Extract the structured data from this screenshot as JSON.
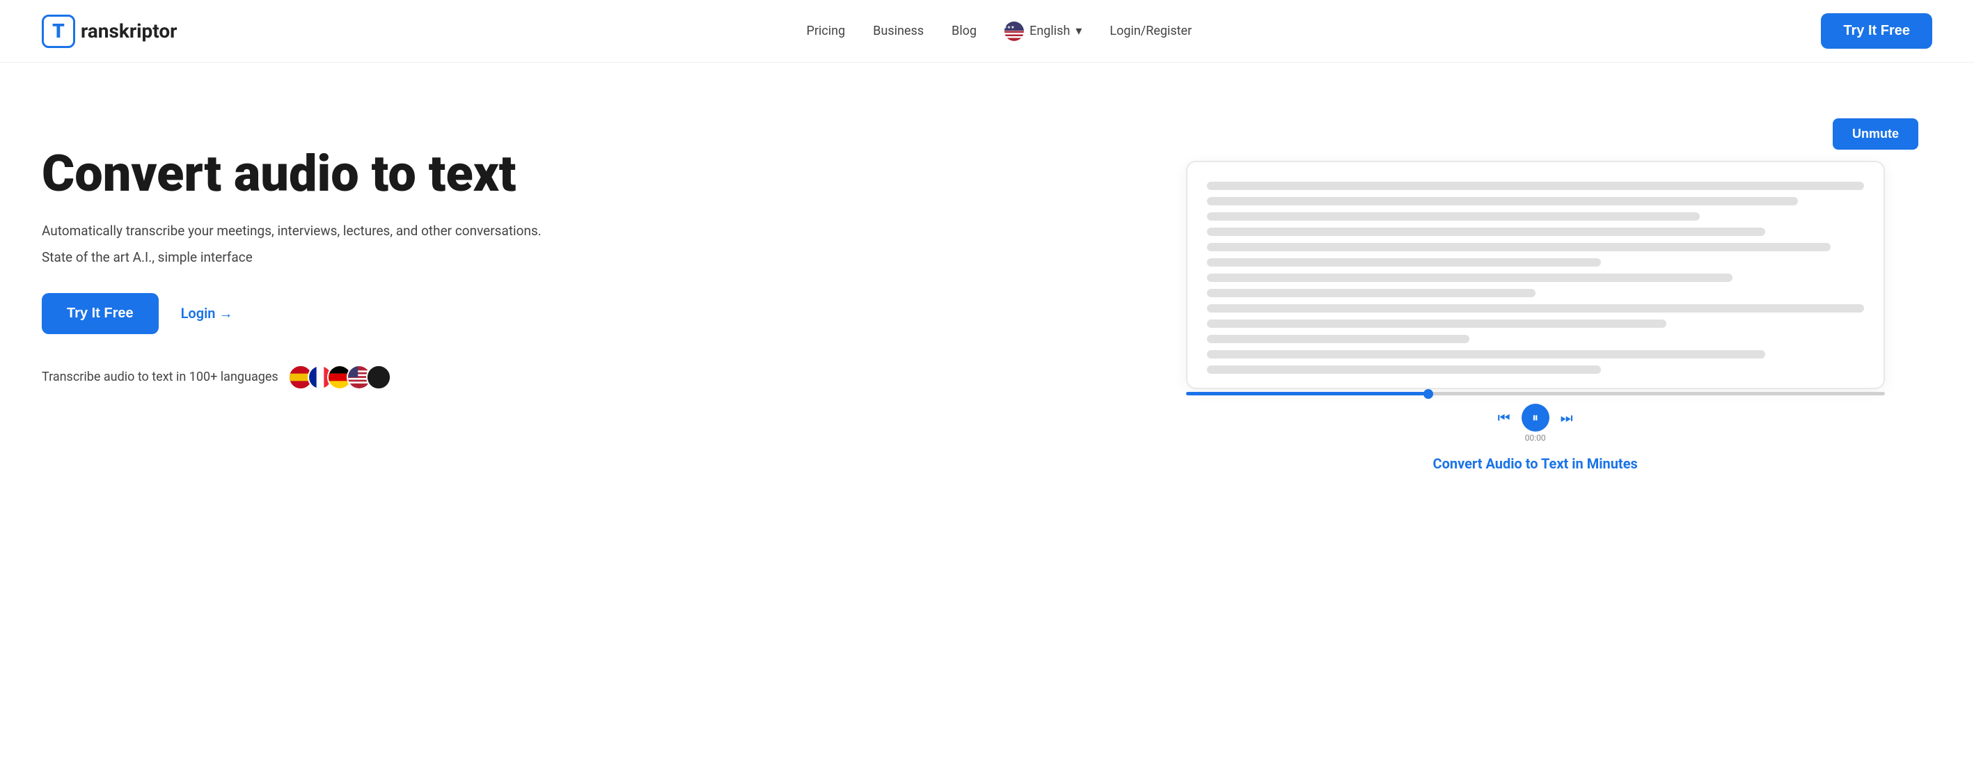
{
  "brand": {
    "logo_letter": "T",
    "name": "ranskriptor",
    "full_name": "Transkriptor"
  },
  "nav": {
    "links": [
      {
        "label": "Pricing",
        "id": "pricing"
      },
      {
        "label": "Business",
        "id": "business"
      },
      {
        "label": "Blog",
        "id": "blog"
      }
    ],
    "language": "English",
    "language_chevron": "▾",
    "login_register": "Login/Register",
    "try_free": "Try It Free"
  },
  "hero": {
    "title": "Convert audio to text",
    "desc1": "Automatically transcribe your meetings, interviews, lectures, and other conversations.",
    "desc2": "State of the art A.I., simple interface",
    "btn_try_free": "Try It Free",
    "btn_login": "Login →",
    "languages_label": "Transcribe audio to text in 100+ languages",
    "unmute_btn": "Unmute",
    "convert_label": "Convert Audio to Text in Minutes"
  },
  "colors": {
    "brand_blue": "#1a73e8",
    "text_dark": "#1a1a1a",
    "text_muted": "#444",
    "line_color": "#e0e0e0"
  }
}
